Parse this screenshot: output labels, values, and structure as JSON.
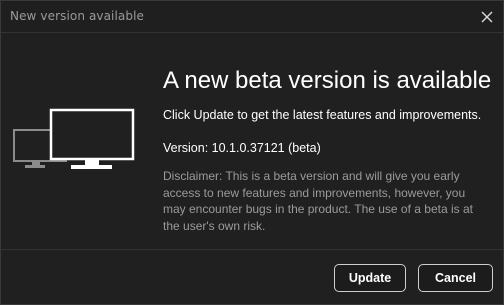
{
  "window": {
    "title": "New version available"
  },
  "dialog": {
    "heading": "A new beta version is available",
    "subtitle": "Click Update to get the latest features and improvements.",
    "version": "Version: 10.1.0.37121 (beta)",
    "disclaimer": "Disclaimer: This is a beta version and will give you early access to new features and improvements, however, you may encounter bugs in the product. The use of a beta is at the user's own risk."
  },
  "buttons": {
    "update_label": "Update",
    "cancel_label": "Cancel"
  },
  "icons": {
    "close": "close-icon",
    "illustration": "monitors-icon"
  },
  "colors": {
    "background": "#202020",
    "text_primary": "#ffffff",
    "text_secondary": "#9b9b9b",
    "border": "#cfcfcf"
  }
}
